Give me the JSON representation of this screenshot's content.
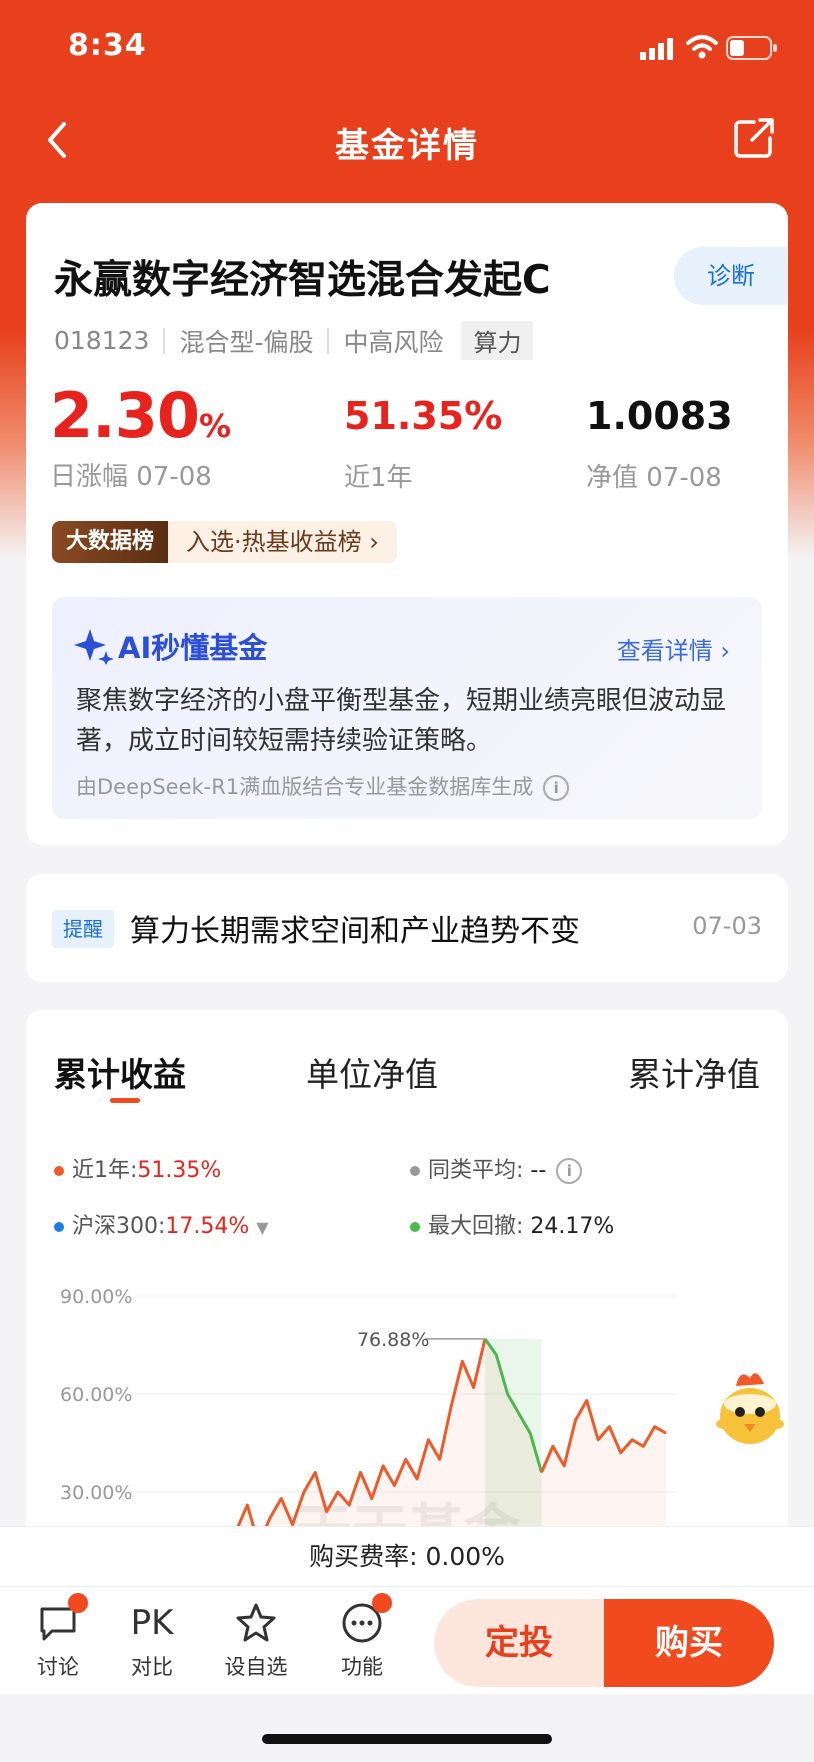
{
  "status_bar": {
    "time": "8:34"
  },
  "nav": {
    "title": "基金详情"
  },
  "fund": {
    "name": "永赢数字经济智选混合发起C",
    "diagnose_label": "诊断",
    "code": "018123",
    "type": "混合型-偏股",
    "risk": "中高风险",
    "tag": "算力"
  },
  "stats": {
    "daily_change_value": "2.30",
    "daily_change_unit": "%",
    "daily_change_label": "日涨幅 07-08",
    "year_return_value": "51.35%",
    "year_return_label": "近1年",
    "nav_value": "1.0083",
    "nav_label": "净值 07-08"
  },
  "rank_badge": {
    "tag": "大数据榜",
    "text": "入选·热基收益榜"
  },
  "ai_summary": {
    "title": "AI秒懂基金",
    "link": "查看详情",
    "description": "聚焦数字经济的小盘平衡型基金，短期业绩亮眼但波动显著，成立时间较短需持续验证策略。",
    "footer": "由DeepSeek-R1满血版结合专业基金数据库生成"
  },
  "notice": {
    "tag": "提醒",
    "text": "算力长期需求空间和产业趋势不变",
    "date": "07-03"
  },
  "chart_tabs": [
    "累计收益",
    "单位净值",
    "累计净值"
  ],
  "legend": {
    "year_label": "近1年:",
    "year_value": "51.35%",
    "peer_label": "同类平均:",
    "peer_value": "--",
    "index_label": "沪深300:",
    "index_value": "17.54%",
    "drawdown_label": "最大回撤:",
    "drawdown_value": "24.17%"
  },
  "colors": {
    "accent": "#e8401c",
    "fund_line": "#f05a28",
    "drawdown_line": "#4cb84c",
    "index_dot": "#1a7fe8",
    "peer_dot": "#999999"
  },
  "chart_data": {
    "type": "line",
    "y_tick_labels": [
      "90.00%",
      "60.00%",
      "30.00%"
    ],
    "ylim": [
      0,
      90
    ],
    "peak_label": "76.88%",
    "series": [
      {
        "name": "近1年",
        "values": [
          18,
          26,
          14,
          22,
          28,
          20,
          30,
          36,
          24,
          30,
          26,
          36,
          28,
          38,
          32,
          40,
          34,
          46,
          40,
          56,
          70,
          62,
          76.88,
          72,
          60,
          54,
          48,
          36,
          44,
          38,
          52,
          58,
          46,
          50,
          42,
          46,
          44,
          50,
          48
        ]
      }
    ],
    "watermark": "天天基金"
  },
  "fee": {
    "label": "购买费率:",
    "value": "0.00%"
  },
  "bottom_bar": {
    "discuss": "讨论",
    "pk_icon_text": "PK",
    "compare": "对比",
    "watchlist": "设自选",
    "functions": "功能",
    "dingtou": "定投",
    "buy": "购买"
  }
}
